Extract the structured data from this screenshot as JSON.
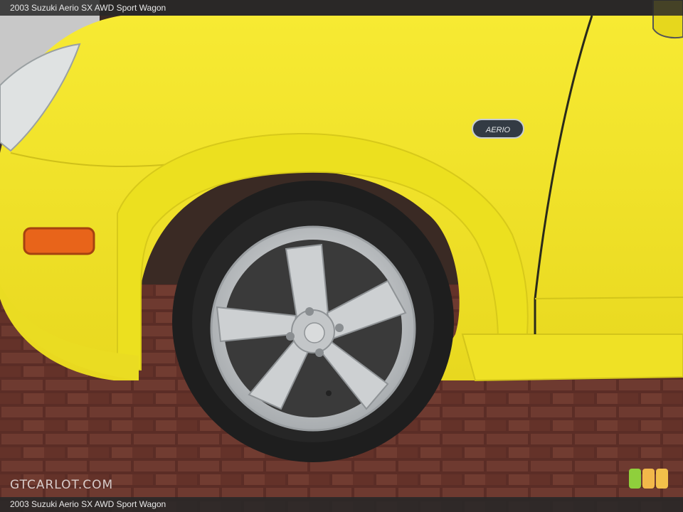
{
  "caption": {
    "top": "2003 Suzuki Aerio SX AWD Sport Wagon",
    "bottom": "2003 Suzuki Aerio SX AWD Sport Wagon"
  },
  "watermark": "GTCARLOT.COM",
  "badge_text": "AERIO",
  "colors": {
    "body": "#f2e52a",
    "body_shade": "#e3d41c",
    "tire": "#1e1e1e",
    "rim": "#c9ccce",
    "marker": "#e8641a",
    "pavement": "#5e2f27"
  },
  "rating_dots": [
    "#8fcf3c",
    "#f2b84a",
    "#f2c04a"
  ]
}
